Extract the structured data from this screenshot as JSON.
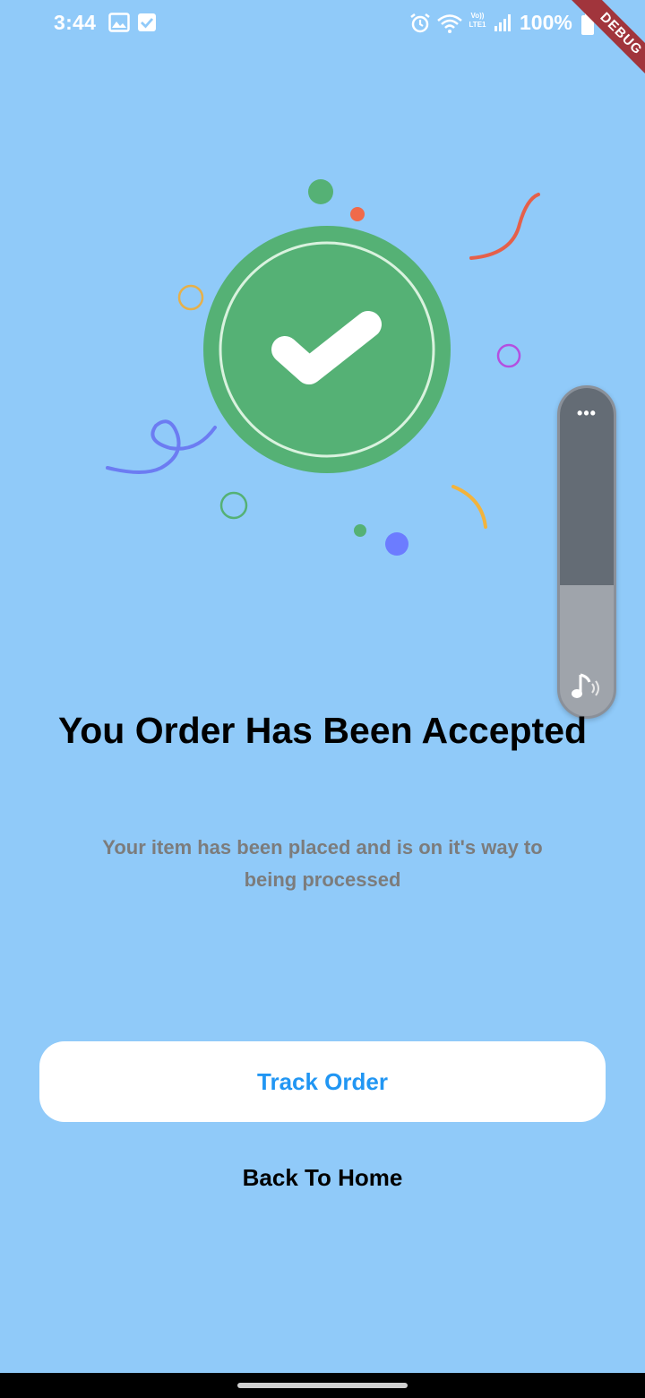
{
  "status_bar": {
    "time": "3:44",
    "network": "Vo)) LTE1",
    "battery": "100%"
  },
  "debug_banner": {
    "label": "DEBUG"
  },
  "illustration": {
    "icon": "check-icon",
    "badge_color": "#55B175",
    "accent_colors": [
      "#55B175",
      "#F06A4A",
      "#6C7CFF",
      "#F2B33D",
      "#B44FE0",
      "#E6B04A"
    ]
  },
  "volume_panel": {
    "menu_icon": "more-dots-icon",
    "mode_icon": "music-note-icon",
    "level": 0.4
  },
  "content": {
    "title": "You Order Has Been Accepted",
    "subtitle": "Your item has been placed and is on it's way to being processed"
  },
  "actions": {
    "track_label": "Track Order",
    "home_label": "Back To Home"
  },
  "colors": {
    "background": "#90CAF9",
    "primary": "#2196F3",
    "button_bg": "#FFFFFF"
  }
}
